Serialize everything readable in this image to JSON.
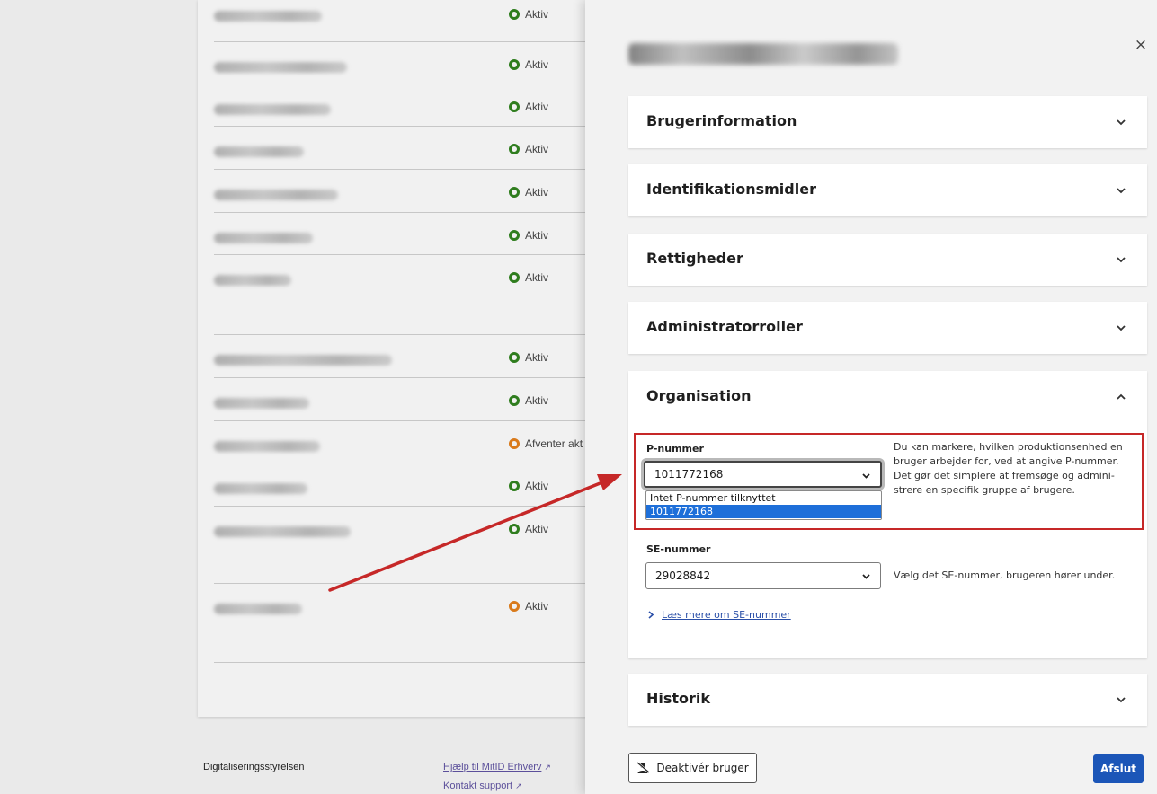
{
  "background_list": {
    "rows": [
      {
        "status": "Aktiv",
        "status_color": "green"
      },
      {
        "status": "Aktiv",
        "status_color": "green"
      },
      {
        "status": "Aktiv",
        "status_color": "green"
      },
      {
        "status": "Aktiv",
        "status_color": "green"
      },
      {
        "status": "Aktiv",
        "status_color": "green"
      },
      {
        "status": "Aktiv",
        "status_color": "green"
      },
      {
        "status": "Aktiv",
        "status_color": "green"
      },
      {
        "status": "Aktiv",
        "status_color": "green"
      },
      {
        "status": "Aktiv",
        "status_color": "green"
      },
      {
        "status": "Afventer akt",
        "status_color": "orange"
      },
      {
        "status": "Aktiv",
        "status_color": "green"
      },
      {
        "status": "Aktiv",
        "status_color": "green"
      },
      {
        "status": "Aktiv",
        "status_color": "orange"
      }
    ]
  },
  "footer": {
    "org_name": "Digitaliseringsstyrelsen",
    "help_link": "Hjælp til MitID Erhverv",
    "support_link": "Kontakt support"
  },
  "drawer": {
    "close_icon": "×",
    "sections": [
      {
        "title": "Brugerinformation",
        "expanded": false
      },
      {
        "title": "Identifikationsmidler",
        "expanded": false
      },
      {
        "title": "Rettigheder",
        "expanded": false
      },
      {
        "title": "Administratorroller",
        "expanded": false
      },
      {
        "title": "Organisation",
        "expanded": true
      },
      {
        "title": "Historik",
        "expanded": false
      }
    ],
    "organisation": {
      "p_label": "P-nummer",
      "p_value": "1011772168",
      "p_options": [
        "Intet P-nummer tilknyttet",
        "1011772168"
      ],
      "p_help": "Du kan markere, hvilken produktionsenhed en bruger arbejder for, ved at angive P-nummer. Det gør det simplere at fremsøge og administrere en specifik gruppe af brugere.",
      "p_help_lines": [
        "Du kan markere, hvilken produktionsenhed en",
        "bruger arbejder for, ved at angive P-nummer.",
        "Det gør det simplere at fremsøge og admini-",
        "strere en specifik gruppe af brugere."
      ],
      "se_label": "SE-nummer",
      "se_value": "29028842",
      "se_help": "Vælg det SE-nummer, brugeren hører under.",
      "se_link": "Læs mere om SE-nummer"
    },
    "deactivate_label": "Deaktivér bruger",
    "finish_label": "Afslut"
  },
  "colors": {
    "primary_button": "#1c56b8",
    "highlight_border": "#c62828",
    "status_green": "#2f7d1e",
    "status_orange": "#d97a1b"
  }
}
